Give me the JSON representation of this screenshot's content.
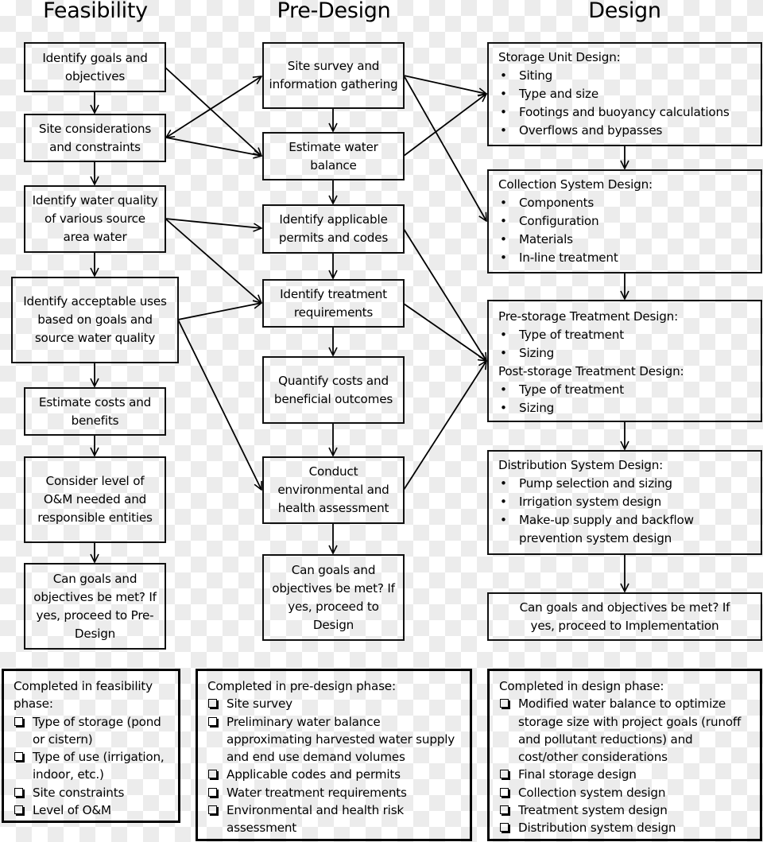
{
  "headers": {
    "feasibility": "Feasibility",
    "predesign": "Pre-Design",
    "design": "Design"
  },
  "feasibility": [
    "Identify goals and objectives",
    "Site considerations and constraints",
    "Identify water quality of various source area water",
    "Identify acceptable uses based on goals and source water quality",
    "Estimate costs and benefits",
    "Consider level of O&M needed and responsible entities",
    "Can goals and objectives be met? If yes, proceed to Pre-Design"
  ],
  "predesign": [
    "Site survey and information gathering",
    "Estimate water balance",
    "Identify applicable permits and codes",
    "Identify treatment requirements",
    "Quantify costs and beneficial outcomes",
    "Conduct environmental and health assessment",
    "Can goals and objectives be met? If yes, proceed to Design"
  ],
  "design": {
    "storage": {
      "title": "Storage Unit Design:",
      "items": [
        "Siting",
        "Type and size",
        "Footings and buoyancy calculations",
        "Overflows and bypasses"
      ]
    },
    "collection": {
      "title": "Collection System Design:",
      "items": [
        "Components",
        "Configuration",
        "Materials",
        "In-line treatment"
      ]
    },
    "treatment": {
      "pre_title": "Pre-storage Treatment Design:",
      "pre_items": [
        "Type of treatment",
        "Sizing"
      ],
      "post_title": "Post-storage Treatment Design:",
      "post_items": [
        "Type of treatment",
        "Sizing"
      ]
    },
    "distribution": {
      "title": "Distribution System Design:",
      "items": [
        "Pump selection and sizing",
        "Irrigation system design",
        "Make-up supply and backflow prevention system design"
      ]
    },
    "final": "Can goals and objectives be met? If yes, proceed to Implementation"
  },
  "summaries": {
    "feasibility": {
      "title": "Completed in feasibility phase:",
      "items": [
        "Type of storage (pond or cistern)",
        "Type of use (irrigation, indoor, etc.)",
        "Site constraints",
        "Level of O&M"
      ]
    },
    "predesign": {
      "title": "Completed in pre-design phase:",
      "items": [
        "Site survey",
        "Preliminary water balance approximating harvested water supply and end use demand volumes",
        "Applicable codes and permits",
        "Water treatment requirements",
        "Environmental and health risk assessment"
      ]
    },
    "design": {
      "title": "Completed in design phase:",
      "items": [
        "Modified water balance to optimize storage size with project goals (runoff and pollutant reductions) and cost/other considerations",
        "Final storage design",
        "Collection system design",
        "Treatment system design",
        "Distribution system design"
      ]
    }
  }
}
